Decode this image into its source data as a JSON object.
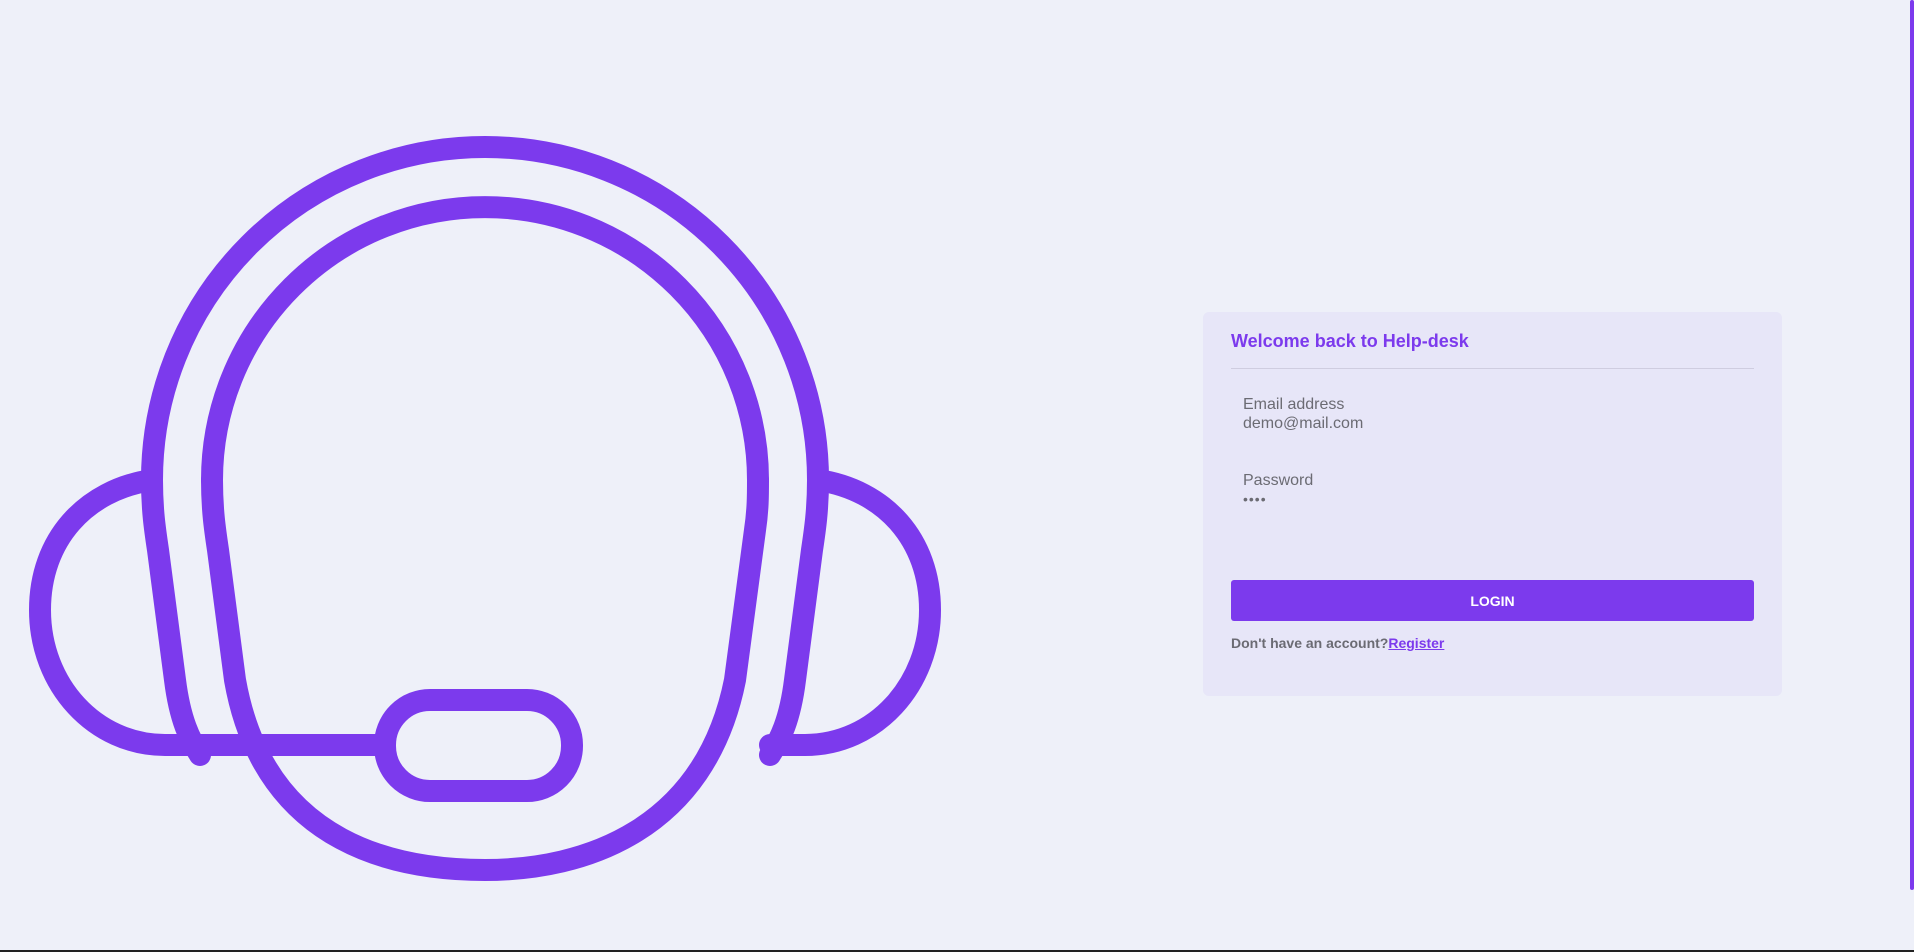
{
  "login_card": {
    "title": "Welcome back to Help-desk",
    "email": {
      "label": "Email address",
      "value": "demo@mail.com"
    },
    "password": {
      "label": "Password",
      "masked_value": "••••"
    },
    "login_button_label": "LOGIN",
    "register_prompt": "Don't have an account?",
    "register_link_label": "Register"
  },
  "illustration": {
    "icon_name": "headset-support-icon"
  },
  "colors": {
    "accent": "#7c3aed",
    "page_background": "#eef0f9",
    "card_background": "#e7e6f8",
    "muted_text": "#6b6b73"
  }
}
